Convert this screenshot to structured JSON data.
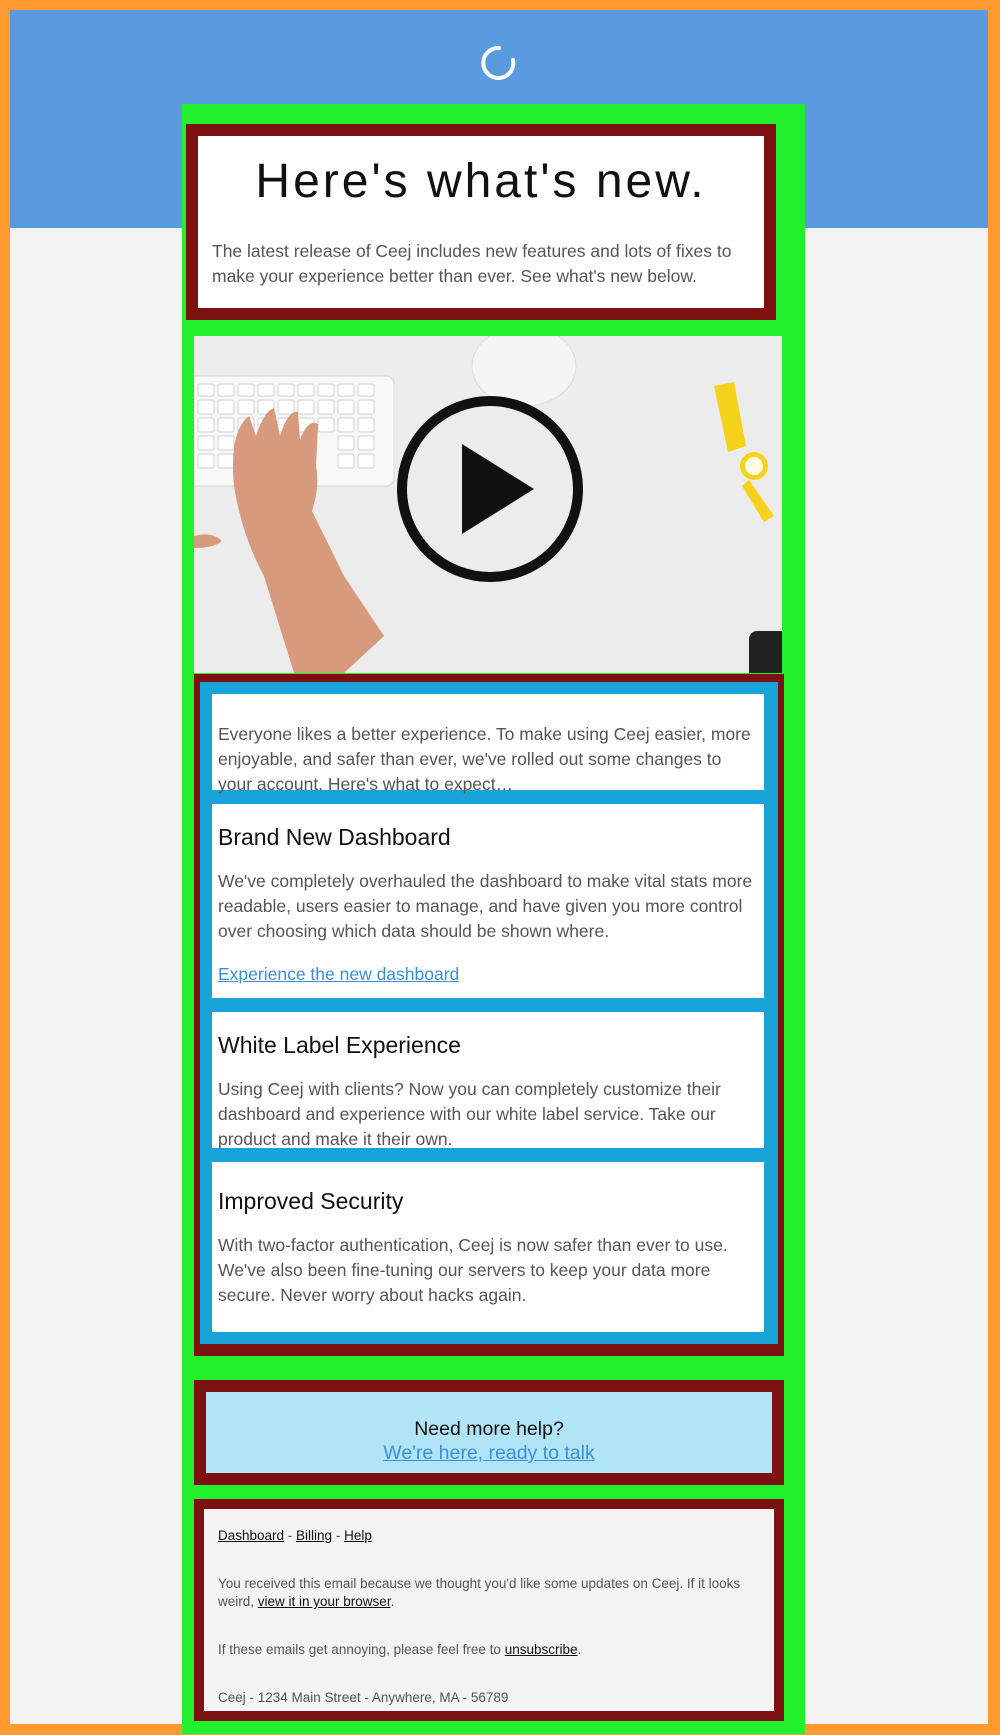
{
  "header": {
    "title": "Here's what's new.",
    "intro": "The latest release of Ceej includes new features and lots of fixes to make your experience better than ever. See what's new below."
  },
  "video": {
    "play_icon": "play-circle-icon"
  },
  "content": {
    "intro": "Everyone likes a better experience. To make using Ceej easier, more enjoyable, and safer than ever, we've rolled out some changes to your account. Here's what to expect…",
    "features": [
      {
        "title": "Brand New Dashboard",
        "text": "We've completely overhauled the dashboard to make vital stats more readable, users easier to manage, and have given you more control over choosing which data should be shown where.",
        "link": "Experience the new dashboard"
      },
      {
        "title": "White Label Experience",
        "text": "Using Ceej with clients? Now you can completely customize their dashboard and experience with our white label service. Take our product and make it their own."
      },
      {
        "title": "Improved Security",
        "text": "With two-factor authentication, Ceej is now safer than ever to use. We've also been fine-tuning our servers to keep your data more secure. Never worry about hacks again."
      }
    ]
  },
  "help": {
    "title": "Need more help?",
    "link": "We're here, ready to talk"
  },
  "footer": {
    "links": [
      "Dashboard",
      "Billing",
      "Help"
    ],
    "separator": " - ",
    "received_text": "You received this email because we thought you'd like some updates on Ceej. If it looks weird, ",
    "view_link": "view it in your browser",
    "annoying_text": "If these emails get annoying, please feel free to ",
    "unsubscribe_link": "unsubscribe",
    "period": ".",
    "address": "Ceej - 1234 Main Street - Anywhere, MA - 56789"
  },
  "colors": {
    "outer_border": "#ff9a2e",
    "hero_band": "#5a9be0",
    "container": "#22f02c",
    "frame": "#7d1010",
    "card_frame": "#19a4d9",
    "help_bg": "#b2e4f8",
    "link": "#3a8fdb"
  }
}
